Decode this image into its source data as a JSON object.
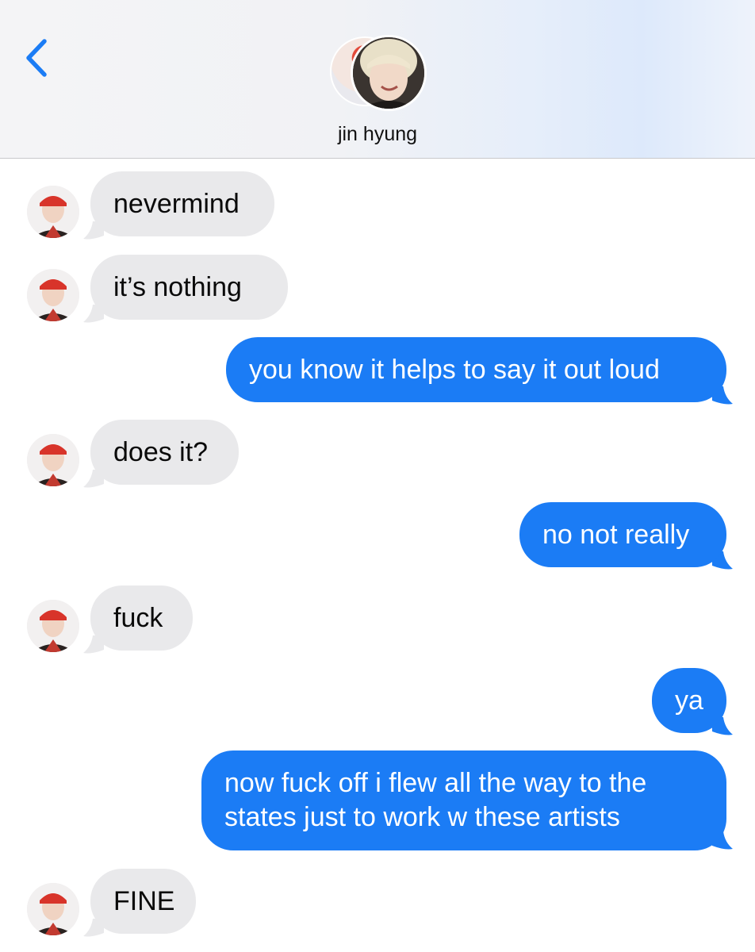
{
  "header": {
    "contact_name": "jin hyung"
  },
  "colors": {
    "outgoing_bubble": "#1b7cf5",
    "incoming_bubble": "#e9e9eb",
    "back_chevron": "#1b7cf5"
  },
  "icons": {
    "back": "chevron-left-icon"
  },
  "messages": [
    {
      "sender": "them",
      "text": "nevermind"
    },
    {
      "sender": "them",
      "text": "it’s nothing"
    },
    {
      "sender": "me",
      "text": "you know it helps to say it out loud"
    },
    {
      "sender": "them",
      "text": "does it?"
    },
    {
      "sender": "me",
      "text": "no not really"
    },
    {
      "sender": "them",
      "text": "fuck"
    },
    {
      "sender": "me",
      "text": "ya"
    },
    {
      "sender": "me",
      "text": "now fuck off i flew all the way to the states just to work w these artists"
    },
    {
      "sender": "them",
      "text": "FINE"
    }
  ]
}
